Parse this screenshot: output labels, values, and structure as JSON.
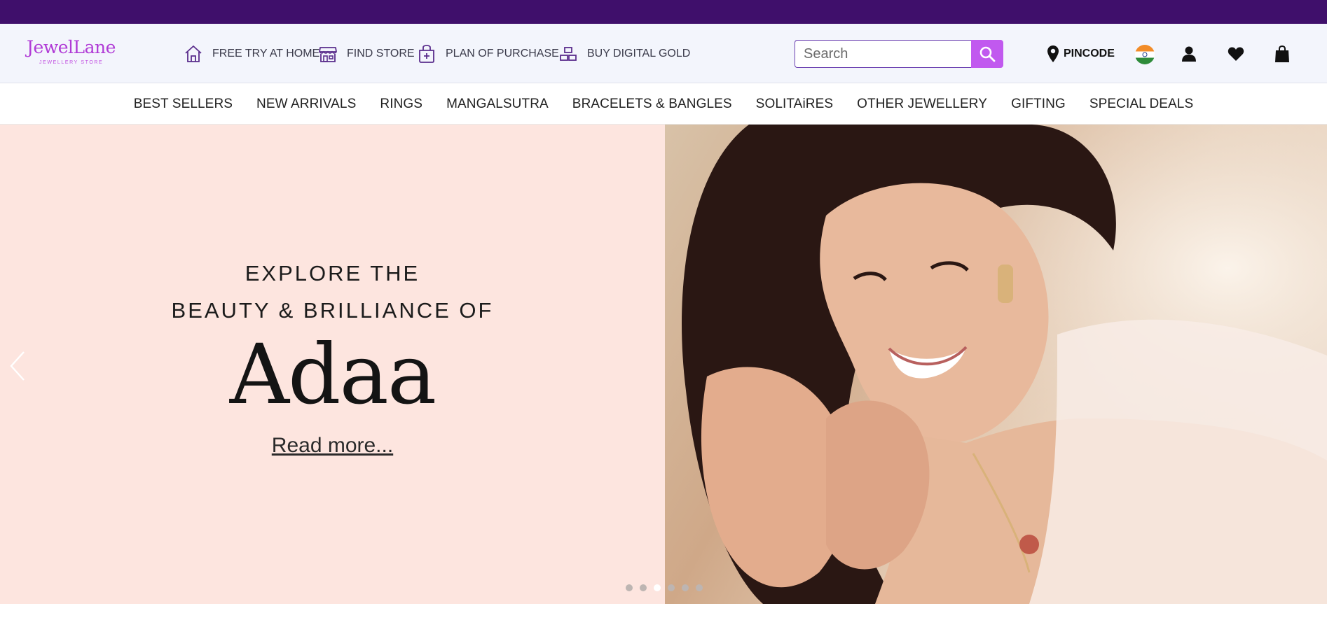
{
  "brand": {
    "name": "JewelLane",
    "tagline": "JEWELLERY STORE"
  },
  "utility_links": [
    {
      "label": "FREE TRY AT HOME",
      "icon": "home-icon"
    },
    {
      "label": "FIND STORE",
      "icon": "store-icon"
    },
    {
      "label": "PLAN OF PURCHASE",
      "icon": "plan-purchase-icon"
    },
    {
      "label": "BUY DIGITAL GOLD",
      "icon": "gold-bars-icon"
    }
  ],
  "search": {
    "placeholder": "Search",
    "button_icon": "search-icon"
  },
  "location": {
    "label": "PINCODE",
    "icon": "map-pin-icon"
  },
  "header_icons": [
    "india-flag-icon",
    "user-icon",
    "heart-icon",
    "shopping-bag-icon"
  ],
  "nav": {
    "items": [
      "BEST SELLERS",
      "NEW ARRIVALS",
      "RINGS",
      "MANGALSUTRA",
      "BRACELETS & BANGLES",
      "SOLITAiRES",
      "OTHER JEWELLERY",
      "GIFTING",
      "SPECIAL DEALS"
    ]
  },
  "hero": {
    "line1": "EXPLORE THE",
    "line2": "BEAUTY & BRILLIANCE OF",
    "collection": "Adaa",
    "cta": "Read more...",
    "slide_count": 6,
    "active_slide": 3
  },
  "colors": {
    "top_strip": "#3f0f6b",
    "brand_pink": "#b03bd6",
    "search_button": "#c159ef",
    "hero_background": "#fde5df"
  }
}
